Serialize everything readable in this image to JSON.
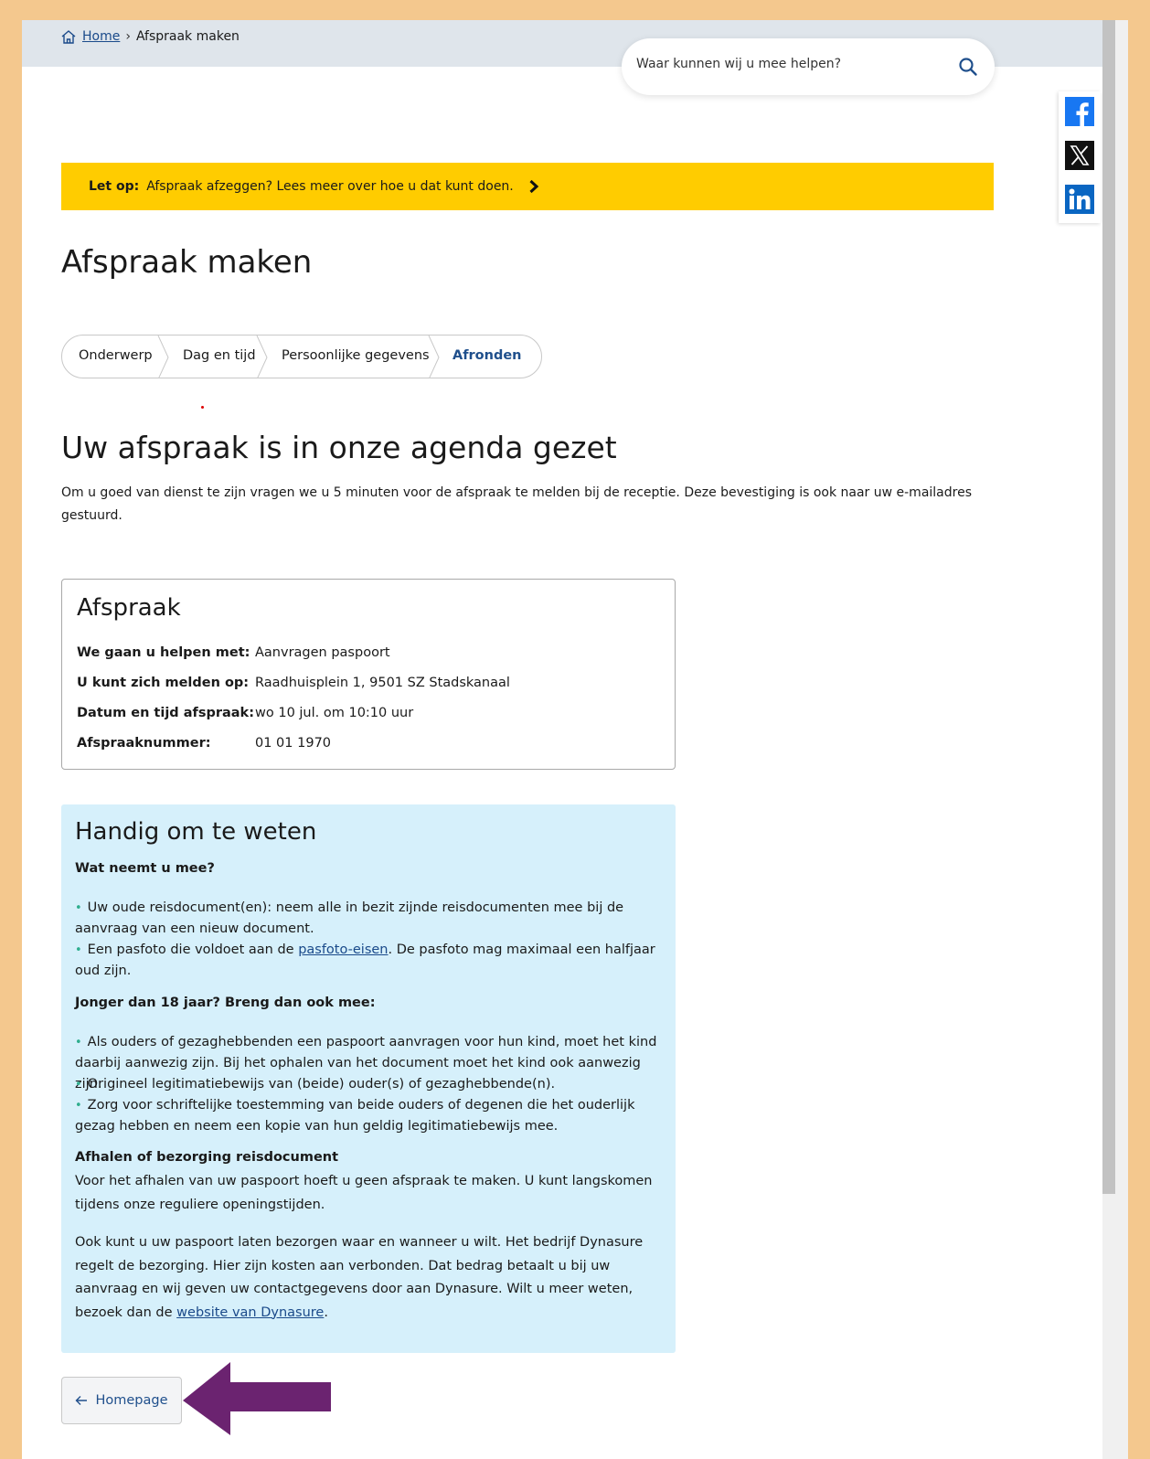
{
  "breadcrumb": {
    "home": "Home",
    "separator": "›",
    "current": "Afspraak maken"
  },
  "search": {
    "placeholder": "Waar kunnen wij u mee helpen?"
  },
  "social": [
    "facebook-icon",
    "x-icon",
    "linkedin-icon"
  ],
  "notice": {
    "label": "Let op:",
    "text": "Afspraak afzeggen? Lees meer over hoe u dat kunt doen."
  },
  "page_title": "Afspraak maken",
  "steps": [
    {
      "label": "Onderwerp"
    },
    {
      "label": "Dag en tijd"
    },
    {
      "label": "Persoonlijke gegevens"
    },
    {
      "label": "Afronden",
      "active": true
    }
  ],
  "confirmation": {
    "title": "Uw afspraak is in onze agenda gezet",
    "intro": "Om u goed van dienst te zijn vragen we u 5 minuten voor de afspraak te melden bij de receptie. Deze bevestiging is ook naar uw e-mailadres gestuurd."
  },
  "appointment": {
    "title": "Afspraak",
    "rows": [
      {
        "key": "We gaan u helpen met:",
        "value": "Aanvragen paspoort"
      },
      {
        "key": "U kunt zich melden op:",
        "value": "Raadhuisplein 1, 9501 SZ Stadskanaal"
      },
      {
        "key": "Datum en tijd afspraak:",
        "value": "wo 10 jul. om 10:10 uur"
      },
      {
        "key": "Afspraaknummer:",
        "value": "01 01 1970"
      }
    ]
  },
  "info": {
    "title": "Handig om te weten",
    "bring_heading": "Wat neemt u mee?",
    "bring_1_line1": "Uw oude reisdocument(en): neem alle in bezit zijnde reisdocumenten mee bij de",
    "bring_1_line2": "aanvraag van een nieuw document.",
    "bring_2_pre": "Een pasfoto die voldoet aan de ",
    "bring_2_link": "pasfoto-eisen",
    "bring_2_post": ". De pasfoto mag maximaal een halfjaar",
    "bring_2_line2": "oud zijn.",
    "minor_heading": "Jonger dan 18 jaar? Breng dan ook mee:",
    "minor_1_line1": "Als ouders of gezaghebbenden een paspoort aanvragen voor hun kind, moet het kind",
    "minor_1_line2": "daarbij aanwezig zijn. Bij het ophalen van het document moet het kind ook aanwezig zijn.",
    "minor_2": "Origineel legitimatiebewijs van (beide) ouder(s) of gezaghebbende(n).",
    "minor_3_line1": "Zorg voor schriftelijke toestemming van beide ouders of degenen die het ouderlijk",
    "minor_3_line2": "gezag hebben en neem een kopie van hun geldig legitimatiebewijs mee.",
    "pickup_heading": "Afhalen of bezorging reisdocument",
    "pickup_text": "Voor het afhalen van uw paspoort hoeft u geen afspraak te maken. U kunt langskomen tijdens onze reguliere openingstijden.",
    "delivery_text": "Ook kunt u uw paspoort laten bezorgen waar en wanneer u wilt. Het bedrijf Dynasure regelt de bezorging. Hier zijn kosten aan verbonden. Dat bedrag betaalt u bij uw aanvraag en wij geven uw contactgegevens door aan Dynasure. Wilt u meer weten, bezoek dan de ",
    "delivery_link": "website van Dynasure",
    "delivery_end": "."
  },
  "home_button": {
    "label": "Homepage"
  },
  "colors": {
    "notice": "#ffcc00",
    "info_bg": "#d6f0fb",
    "accent": "#1f4f8c",
    "arrow": "#6b2370",
    "frame": "#f4c88e"
  }
}
